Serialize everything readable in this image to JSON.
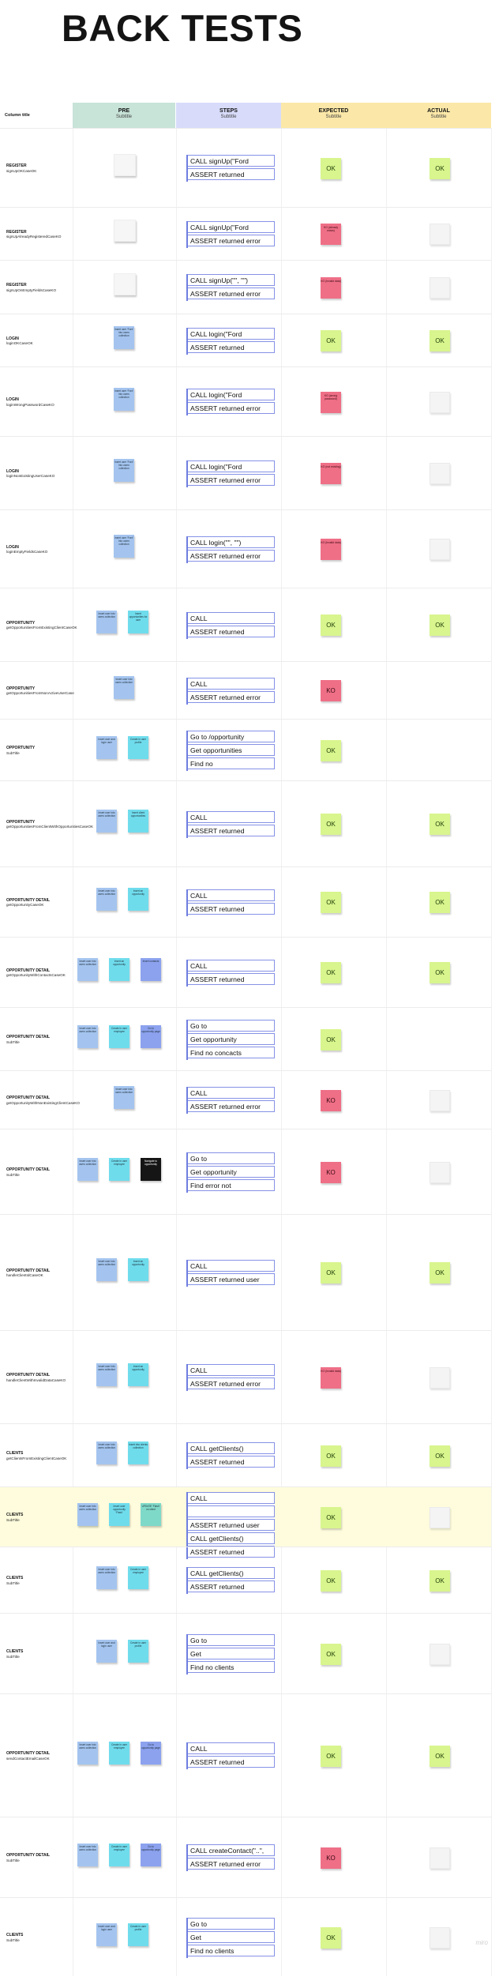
{
  "title": "BACK TESTS",
  "header": {
    "column_label": "Column title",
    "columns": [
      {
        "title": "PRE",
        "subtitle": "Subtitle",
        "color": "#c8e3d8"
      },
      {
        "title": "STEPS",
        "subtitle": "Subtitle",
        "color": "#d8dcfa"
      },
      {
        "title": "EXPECTED",
        "subtitle": "Subtitle",
        "color": "#fbe8a8"
      },
      {
        "title": "ACTUAL",
        "subtitle": "Subtitle",
        "color": "#fbe8a8"
      }
    ]
  },
  "rows": [
    {
      "label": "REGISTER",
      "sub": "signUpOKCaseOK",
      "pre": [
        {
          "c": "white",
          "t": ""
        }
      ],
      "steps": [
        "CALL signUp(\"Ford",
        "ASSERT returned"
      ],
      "exp": {
        "k": "ok",
        "t": "OK"
      },
      "act": {
        "k": "ok",
        "t": "OK"
      }
    },
    {
      "label": "REGISTER",
      "sub": "signUpAlreadyRegisteredCaseKO",
      "pre": [
        {
          "c": "white",
          "t": ""
        }
      ],
      "steps": [
        "CALL signUp(\"Ford",
        "ASSERT returned error"
      ],
      "exp": {
        "k": "ko",
        "t": "KO (already exists)"
      },
      "act": {
        "k": "blank",
        "t": ""
      }
    },
    {
      "label": "REGISTER",
      "sub": "signUpOnEmptyFieldsCaseKO",
      "pre": [
        {
          "c": "white",
          "t": ""
        }
      ],
      "steps": [
        "CALL signUp(\"\", \"\")",
        "ASSERT returned error"
      ],
      "exp": {
        "k": "ko",
        "t": "KO (Invalid data)"
      },
      "act": {
        "k": "blank",
        "t": ""
      }
    },
    {
      "label": "LOGIN",
      "sub": "loginOKCaseOK",
      "pre": [
        {
          "c": "blue",
          "t": "Insert user ‘Ford’ into users collection"
        }
      ],
      "steps": [
        "CALL login(\"Ford",
        "ASSERT returned"
      ],
      "exp": {
        "k": "ok",
        "t": "OK"
      },
      "act": {
        "k": "ok",
        "t": "OK"
      }
    },
    {
      "label": "LOGIN",
      "sub": "loginWrongPasswordCaseKO",
      "pre": [
        {
          "c": "blue",
          "t": "Insert user ‘Ford’ into users collection"
        }
      ],
      "steps": [
        "CALL login(\"Ford",
        "ASSERT returned error"
      ],
      "exp": {
        "k": "ko",
        "t": "KO (wrong password)"
      },
      "act": {
        "k": "blank",
        "t": ""
      }
    },
    {
      "label": "LOGIN",
      "sub": "loginNonExistingUserCaseKO",
      "pre": [
        {
          "c": "blue",
          "t": "Insert user ‘Ford’ into users collection"
        }
      ],
      "steps": [
        "CALL login(\"Ford",
        "ASSERT returned error"
      ],
      "exp": {
        "k": "ko",
        "t": "KO (not existing)"
      },
      "act": {
        "k": "blank",
        "t": ""
      }
    },
    {
      "label": "LOGIN",
      "sub": "loginEmptyFieldsCaseKO",
      "pre": [
        {
          "c": "blue",
          "t": "Insert user ‘Ford’ into users collection"
        }
      ],
      "steps": [
        "CALL login(\"\", \"\")",
        "ASSERT returned error"
      ],
      "exp": {
        "k": "ko",
        "t": "KO (Invalid data)"
      },
      "act": {
        "k": "blank",
        "t": ""
      }
    },
    {
      "label": "OPPORTUNITY",
      "sub": "getOpportunitiesFromExistingClientCaseOK",
      "pre": [
        {
          "c": "blue",
          "t": "Insert user into users collection"
        },
        {
          "c": "cyan",
          "t": "Insert opportunities for user"
        }
      ],
      "steps": [
        "CALL",
        "ASSERT returned"
      ],
      "exp": {
        "k": "ok",
        "t": "OK"
      },
      "act": {
        "k": "ok",
        "t": "OK"
      }
    },
    {
      "label": "OPPORTUNITY",
      "sub": "getOpportunitiesFromNonActiveUserCase",
      "pre": [
        {
          "c": "blue",
          "t": "Insert user into users collection"
        }
      ],
      "steps": [
        "CALL",
        "ASSERT returned error"
      ],
      "exp": {
        "k": "ko",
        "t": "KO"
      },
      "act": {
        "k": "none",
        "t": ""
      }
    },
    {
      "label": "OPPORTUNITY",
      "sub": "SubTitle",
      "pre": [
        {
          "c": "blue",
          "t": "Insert user and login user"
        },
        {
          "c": "cyan",
          "t": "Create in user profile"
        }
      ],
      "steps": [
        "Go to /opportunity",
        "Get opportunities",
        "Find no"
      ],
      "exp": {
        "k": "ok",
        "t": "OK"
      },
      "act": {
        "k": "none",
        "t": ""
      }
    },
    {
      "label": "OPPORTUNITY",
      "sub": "getOpportunitiesFromClientWithOpportunitiesCaseOK",
      "pre": [
        {
          "c": "blue",
          "t": "Insert user into users collection"
        },
        {
          "c": "cyan",
          "t": "Insert client opportunities"
        }
      ],
      "steps": [
        "CALL",
        "ASSERT returned"
      ],
      "exp": {
        "k": "ok",
        "t": "OK"
      },
      "act": {
        "k": "ok",
        "t": "OK"
      }
    },
    {
      "label": "OPPORTUNITY DETAIL",
      "sub": "getOpportunityCaseOK",
      "pre": [
        {
          "c": "blue",
          "t": "Insert user into users collection"
        },
        {
          "c": "cyan",
          "t": "Insert an opportunity"
        }
      ],
      "steps": [
        "CALL",
        "ASSERT returned"
      ],
      "exp": {
        "k": "ok",
        "t": "OK"
      },
      "act": {
        "k": "ok",
        "t": "OK"
      }
    },
    {
      "label": "OPPORTUNITY DETAIL",
      "sub": "getOpportunityWithContactsCaseOK",
      "pre": [
        {
          "c": "blue",
          "t": "Insert user into users collection"
        },
        {
          "c": "cyan",
          "t": "Insert an opportunity"
        },
        {
          "c": "violet",
          "t": "Insert contacts"
        }
      ],
      "steps": [
        "CALL",
        "ASSERT returned"
      ],
      "exp": {
        "k": "ok",
        "t": "OK"
      },
      "act": {
        "k": "ok",
        "t": "OK"
      }
    },
    {
      "label": "OPPORTUNITY DETAIL",
      "sub": "SubTitle",
      "pre": [
        {
          "c": "blue",
          "t": "Insert user into users collection"
        },
        {
          "c": "cyan",
          "t": "Create in user employee"
        },
        {
          "c": "violet",
          "t": "Go to opportunity page"
        }
      ],
      "steps": [
        "Go to",
        "Get opportunity",
        "Find no concacts"
      ],
      "exp": {
        "k": "ok",
        "t": "OK"
      },
      "act": {
        "k": "none",
        "t": ""
      }
    },
    {
      "label": "OPPORTUNITY DETAIL",
      "sub": "getOpportunityWithNonExistingClientCaseKO",
      "pre": [
        {
          "c": "blue",
          "t": "Insert user into users collection"
        }
      ],
      "steps": [
        "CALL",
        "ASSERT returned error"
      ],
      "exp": {
        "k": "ko",
        "t": "KO"
      },
      "act": {
        "k": "blank",
        "t": ""
      }
    },
    {
      "label": "OPPORTUNITY DETAIL",
      "sub": "SubTitle",
      "pre": [
        {
          "c": "blue",
          "t": "Insert user into users collection"
        },
        {
          "c": "cyan",
          "t": "Create in user employee"
        },
        {
          "c": "black",
          "t": "Navigate to opportunity"
        }
      ],
      "steps": [
        "Go to",
        "Get opportunity",
        "Find error not"
      ],
      "exp": {
        "k": "ko",
        "t": "KO"
      },
      "act": {
        "k": "blank",
        "t": ""
      }
    },
    {
      "label": "OPPORTUNITY DETAIL",
      "sub": "handleClientIdCaseOK",
      "pre": [
        {
          "c": "blue",
          "t": "Insert user into users collection"
        },
        {
          "c": "cyan",
          "t": "Insert an opportunity"
        }
      ],
      "steps": [
        "CALL",
        "ASSERT returned user"
      ],
      "exp": {
        "k": "ok",
        "t": "OK"
      },
      "act": {
        "k": "ok",
        "t": "OK"
      }
    },
    {
      "label": "OPPORTUNITY DETAIL",
      "sub": "handleClientWithInvalidDataCaseKO",
      "pre": [
        {
          "c": "blue",
          "t": "Insert user into users collection"
        },
        {
          "c": "cyan",
          "t": "Insert an opportunity"
        }
      ],
      "steps": [
        "CALL",
        "ASSERT returned error"
      ],
      "exp": {
        "k": "ko",
        "t": "KO (Invalid data)"
      },
      "act": {
        "k": "blank",
        "t": ""
      }
    },
    {
      "label": "CLIENTS",
      "sub": "getClientsFromExistingClientCaseOK",
      "pre": [
        {
          "c": "blue",
          "t": "Insert user into users collection"
        },
        {
          "c": "cyan",
          "t": "Insert into clients collection"
        }
      ],
      "steps": [
        "CALL getClients()",
        "ASSERT returned"
      ],
      "exp": {
        "k": "ok",
        "t": "OK"
      },
      "act": {
        "k": "ok",
        "t": "OK"
      }
    },
    {
      "label": "CLIENTS",
      "sub": "SubTitle",
      "hl": true,
      "pre": [
        {
          "c": "blue",
          "t": "Insert user into users collection"
        },
        {
          "c": "cyan",
          "t": "Insert user opportunity ‘Flash’"
        },
        {
          "c": "teal",
          "t": "UPDATE ‘Flash’ on client"
        }
      ],
      "steps": [
        "CALL",
        "",
        "ASSERT returned user",
        "CALL getClients()",
        "ASSERT returned"
      ],
      "exp": {
        "k": "ok",
        "t": "OK"
      },
      "act": {
        "k": "blank",
        "t": ""
      }
    },
    {
      "label": "CLIENTS",
      "sub": "SubTitle",
      "pre": [
        {
          "c": "blue",
          "t": "Insert user into users collection"
        },
        {
          "c": "cyan",
          "t": "Create in user employee"
        }
      ],
      "steps": [
        "CALL getClients()",
        "ASSERT returned"
      ],
      "exp": {
        "k": "ok",
        "t": "OK"
      },
      "act": {
        "k": "ok",
        "t": "OK"
      }
    },
    {
      "label": "CLIENTS",
      "sub": "SubTitle",
      "pre": [
        {
          "c": "blue",
          "t": "Insert user and login user"
        },
        {
          "c": "cyan",
          "t": "Create in user profile"
        }
      ],
      "steps": [
        "Go to",
        "Get",
        "Find no clients"
      ],
      "exp": {
        "k": "ok",
        "t": "OK"
      },
      "act": {
        "k": "blank",
        "t": ""
      }
    },
    {
      "label": "OPPORTUNITY DETAIL",
      "sub": "sendContactEmailCaseOK",
      "pre": [
        {
          "c": "blue",
          "t": "Insert user into users collection"
        },
        {
          "c": "cyan",
          "t": "Create in user employee"
        },
        {
          "c": "violet",
          "t": "Go to opportunity page"
        }
      ],
      "steps": [
        "CALL",
        "ASSERT returned"
      ],
      "exp": {
        "k": "ok",
        "t": "OK"
      },
      "act": {
        "k": "ok",
        "t": "OK"
      }
    },
    {
      "label": "OPPORTUNITY DETAIL",
      "sub": "SubTitle",
      "pre": [
        {
          "c": "blue",
          "t": "Insert user into users collection"
        },
        {
          "c": "cyan",
          "t": "Create in user employee"
        },
        {
          "c": "violet",
          "t": "Go to opportunity page"
        }
      ],
      "steps": [
        "CALL createContact(\"..\",",
        "ASSERT returned error"
      ],
      "exp": {
        "k": "ko",
        "t": "KO"
      },
      "act": {
        "k": "blank",
        "t": ""
      }
    },
    {
      "label": "CLIENTS",
      "sub": "SubTitle",
      "pre": [
        {
          "c": "blue",
          "t": "Insert user and login user"
        },
        {
          "c": "cyan",
          "t": "Create in user profile"
        }
      ],
      "steps": [
        "Go to",
        "Get",
        "Find no clients"
      ],
      "exp": {
        "k": "ok",
        "t": "OK"
      },
      "act": {
        "k": "blank",
        "t": ""
      }
    }
  ],
  "watermark": "miro"
}
